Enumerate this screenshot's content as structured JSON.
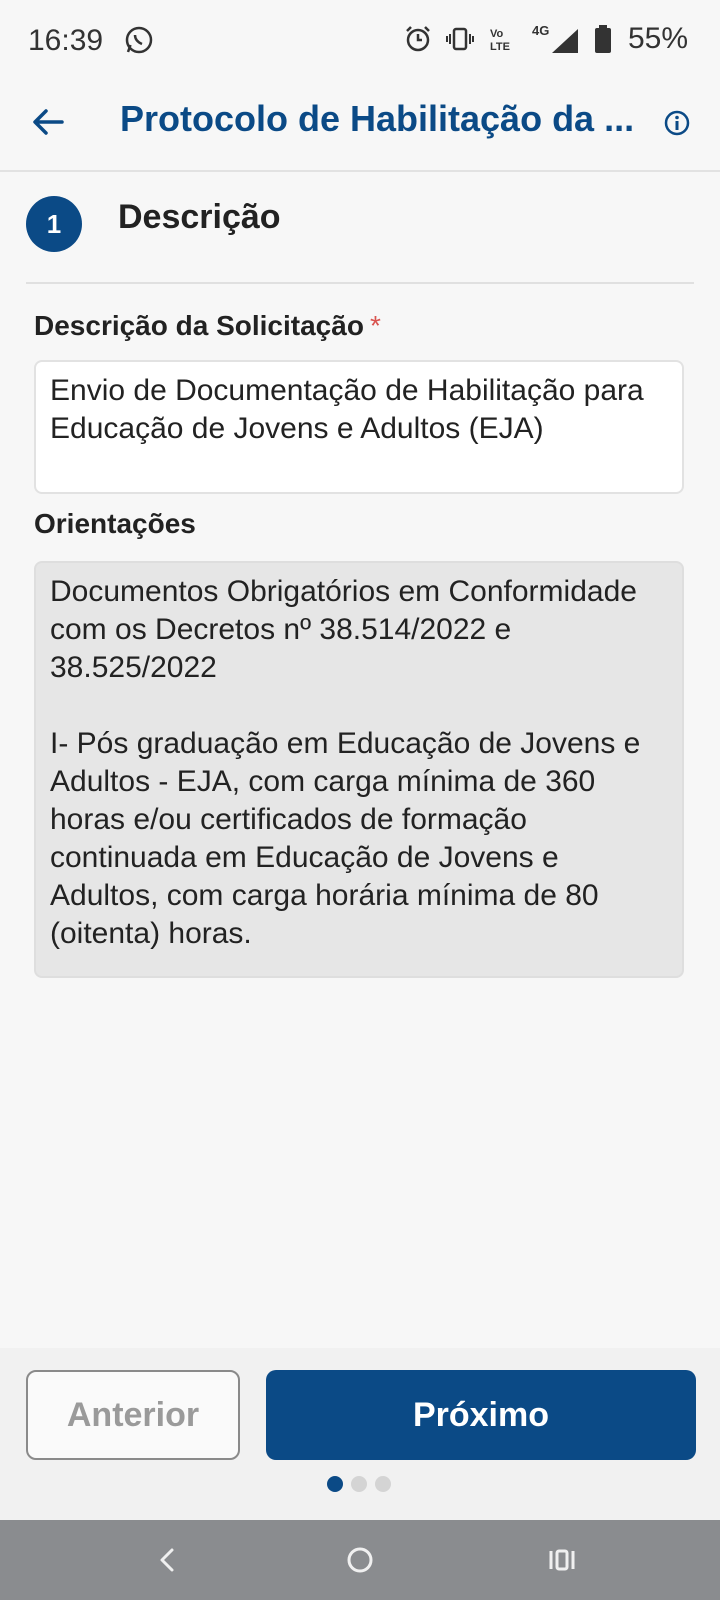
{
  "status_bar": {
    "time": "16:39",
    "battery_pct": "55%",
    "network": "4G",
    "volte": "Vo LTE",
    "icons": [
      "whatsapp-icon",
      "alarm-icon",
      "vibrate-icon",
      "volte-icon",
      "signal-icon",
      "battery-icon"
    ]
  },
  "app_bar": {
    "title": "Protocolo de Habilitação da ...",
    "back_icon": "arrow-left-icon",
    "info_icon": "info-icon"
  },
  "step": {
    "number": "1",
    "title": "Descrição"
  },
  "form": {
    "description_label": "Descrição da Solicitação",
    "required_mark": "*",
    "description_value": "Envio de Documentação de Habilitação para Educação de Jovens e Adultos (EJA)",
    "orientation_label": "Orientações",
    "orientation_text": "Documentos Obrigatórios em Conformidade com os Decretos nº 38.514/2022 e 38.525/2022\n\nI- Pós graduação em Educação de Jovens e Adultos - EJA, com carga mínima de 360 horas e/ou certificados de formação continuada em Educação de Jovens e Adultos, com carga horária mínima de 80 (oitenta) horas."
  },
  "footer": {
    "prev_label": "Anterior",
    "next_label": "Próximo",
    "pages": 3,
    "current_page": 1
  },
  "colors": {
    "primary": "#0b4a86",
    "required": "#d9534f"
  }
}
